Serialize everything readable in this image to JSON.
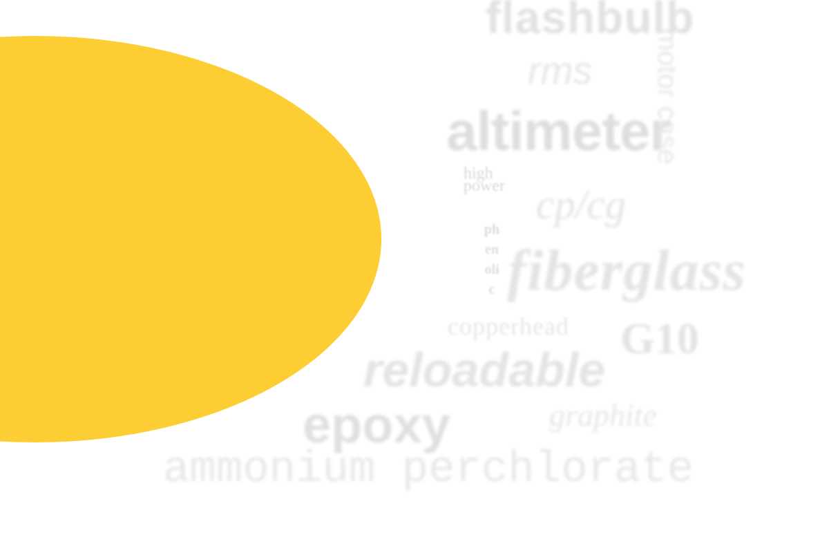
{
  "word_cloud": {
    "flashbulb": "flashbulb",
    "rms": "rms",
    "altimeter": "altimeter",
    "vertical_word": "motor case",
    "high_power_line1": "high",
    "high_power_line2": "power",
    "cp_cg": "cp/cg",
    "phenolic": "phenolic",
    "fiberglass": "fiberglass",
    "copperhead": "copperhead",
    "g10": "G10",
    "reloadable": "reloadable",
    "epoxy": "epoxy",
    "graphite": "graphite",
    "ammonium_perchlorate": "ammonium perchlorate"
  },
  "colors": {
    "accent_blob": "#fdce33",
    "background": "#ffffff",
    "word_gray": "#e4e4e4"
  }
}
